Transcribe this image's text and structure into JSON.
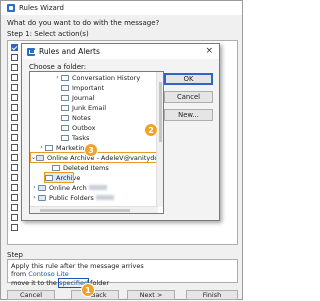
{
  "wizard": {
    "title": "Rules Wizard",
    "question": "What do you want to do with the message?",
    "step1": "Step 1: Select action(s)",
    "step2": "Step",
    "description_lines": {
      "line1": "Apply this rule after the message arrives",
      "line2_prefix": "from ",
      "line2_link": "Contoso Lite",
      "line3_prefix": "move it to the ",
      "line3_link": "specified",
      "line3_suffix": " folder"
    },
    "buttons": {
      "cancel": "Cancel",
      "back": "< Back",
      "next": "Next >",
      "finish": "Finish"
    }
  },
  "dialog": {
    "title": "Rules and Alerts",
    "close_glyph": "×",
    "choose_label": "Choose a folder:",
    "buttons": {
      "ok": "OK",
      "cancel": "Cancel",
      "new": "New..."
    },
    "tree": [
      {
        "label": "Conversation History",
        "arrow": "›"
      },
      {
        "label": "Important",
        "arrow": ""
      },
      {
        "label": "Journal",
        "arrow": ""
      },
      {
        "label": "Junk Email",
        "arrow": ""
      },
      {
        "label": "Notes",
        "arrow": ""
      },
      {
        "label": "Outbox",
        "arrow": ""
      },
      {
        "label": "Tasks",
        "arrow": ""
      },
      {
        "label": "Marketing",
        "arrow": "›"
      },
      {
        "label": "Online Archive - AdeleV@vanitydom...",
        "arrow": "⌄"
      },
      {
        "label": "Deleted Items",
        "arrow": ""
      },
      {
        "label": "Archive",
        "arrow": ""
      },
      {
        "label": "Online Arch",
        "arrow": "›"
      },
      {
        "label": "Public Folders",
        "arrow": "›"
      }
    ]
  },
  "callouts": {
    "one": "1",
    "two": "2",
    "three": "3"
  },
  "colors": {
    "callout": "#f0a325",
    "link": "#1a56b0",
    "selection": "#dbe9fa"
  }
}
